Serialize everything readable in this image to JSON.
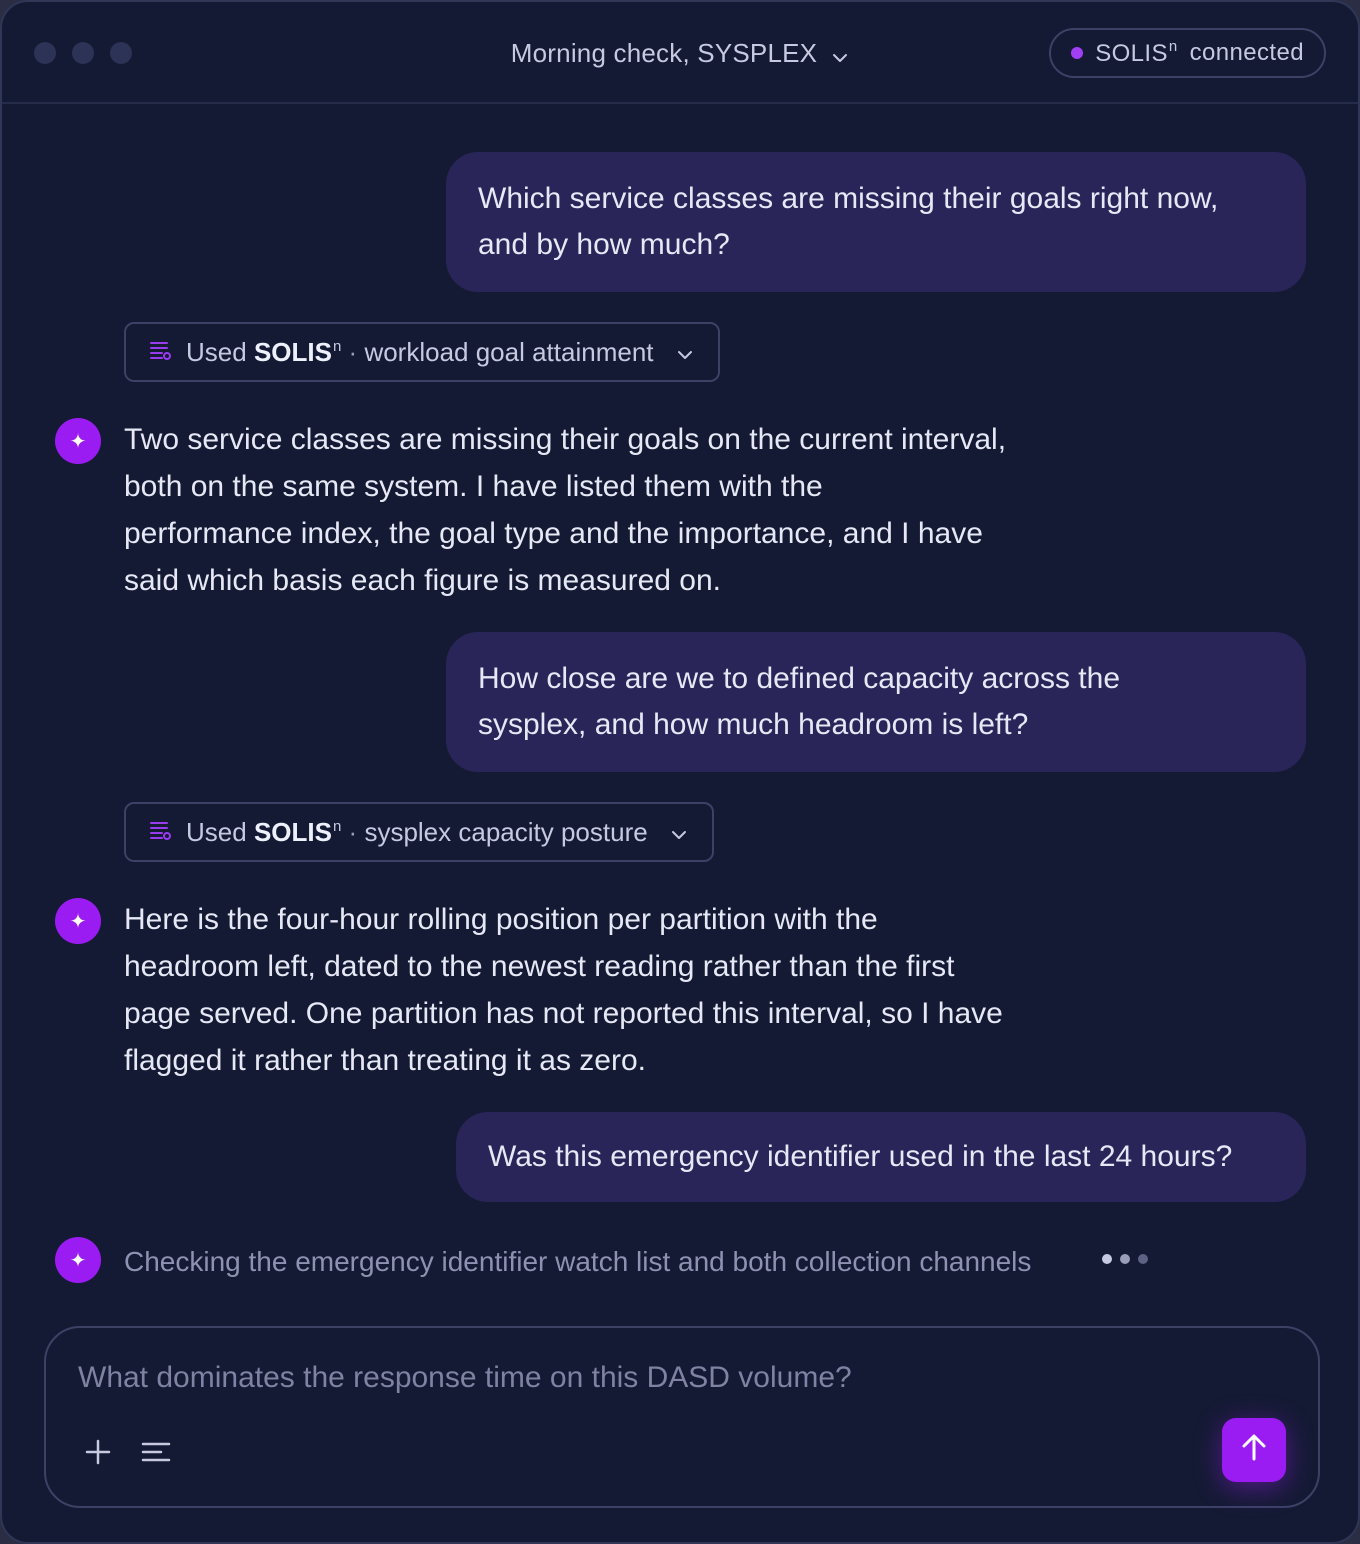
{
  "window": {
    "title": "Morning check, SYSPLEX",
    "status": {
      "label": "SOLIS",
      "superscript": "n",
      "text": "connected"
    }
  },
  "conversation": {
    "messages": [
      {
        "role": "user",
        "lines": [
          "Which service classes are missing their goals right now,",
          "and by how much?"
        ]
      },
      {
        "role": "tool",
        "used": "Used",
        "brand": "SOLIS",
        "brand_sup": "n",
        "separator": "·",
        "tool_name": "workload goal attainment"
      },
      {
        "role": "assistant",
        "lines": [
          "Two service classes are missing their goals on the current interval,",
          "both on the same system. I have listed them with the",
          "performance index, the goal type and the importance, and I have",
          "said which basis each figure is measured on."
        ]
      },
      {
        "role": "user",
        "lines": [
          "How close are we to defined capacity across the",
          "sysplex, and how much headroom is left?"
        ]
      },
      {
        "role": "tool",
        "used": "Used",
        "brand": "SOLIS",
        "brand_sup": "n",
        "separator": "·",
        "tool_name": "sysplex capacity posture"
      },
      {
        "role": "assistant",
        "lines": [
          "Here is the four-hour rolling position per partition with the",
          "headroom left, dated to the newest reading rather than the first",
          "page served. One partition has not reported this interval, so I have",
          "flagged it rather than treating it as zero."
        ]
      },
      {
        "role": "user",
        "lines": [
          "Was this emergency identifier used in the last 24 hours?"
        ]
      }
    ],
    "pending": {
      "text": "Checking the emergency identifier watch list and both collection channels"
    }
  },
  "composer": {
    "placeholder": "What dominates the response time on this DASD volume?",
    "value": ""
  },
  "icons": {
    "dropdown": "chevron-down-icon",
    "tool": "list-settings-icon",
    "assistant": "sparkle-icon",
    "attach": "plus-icon",
    "tools": "lines-icon",
    "send": "arrow-up-icon"
  },
  "colors": {
    "background": "#141a33",
    "accent": "#9b1cf3",
    "user_bubble": "#2a2559",
    "status_dot": "#a13ff5",
    "text_primary": "#e7e8f5",
    "text_muted": "#8e91b2"
  }
}
